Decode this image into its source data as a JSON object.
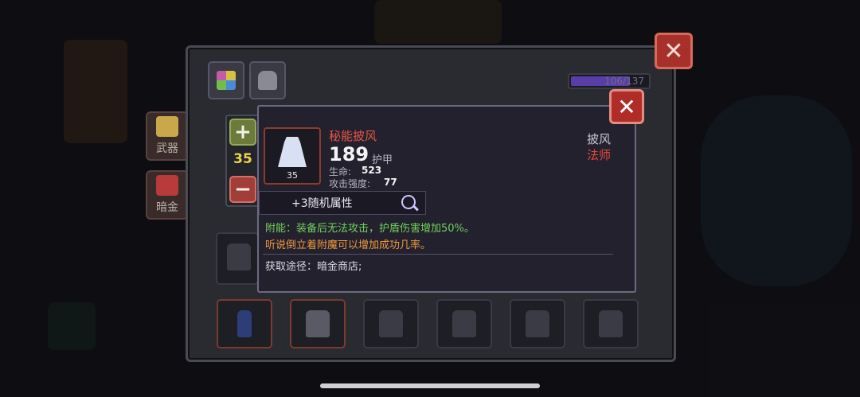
{
  "side_menu": {
    "weapons_label": "武器",
    "dark_gold_label": "暗金"
  },
  "panel": {
    "capacity_text": "106/137",
    "capacity_fraction": 0.77,
    "tabs": [
      {
        "icon": "palette-icon"
      },
      {
        "icon": "skull-helmet-icon"
      }
    ],
    "close_label": "✕"
  },
  "stepper": {
    "plus_label": "+",
    "value": "35",
    "minus_label": "−"
  },
  "item": {
    "name": "秘能披风",
    "level": "35",
    "armor_value": "189",
    "armor_label": "护甲",
    "stats": [
      {
        "label": "生命:",
        "value": "523"
      },
      {
        "label": "攻击强度:",
        "value": "77"
      }
    ],
    "type": "披风",
    "class": "法师",
    "random_attrs_label": "+3随机属性",
    "enchant_text": "附能：装备后无法攻击，护盾伤害增加50%。",
    "hint_text": "听说倒立着附魔可以增加成功几率。",
    "source_text": "获取途径：暗金商店;",
    "close_label": "✕"
  },
  "colors": {
    "rarity_name": "#e8544a",
    "class_color": "#e8473a",
    "enchant_color": "#6fd15a",
    "hint_color": "#ef9a3c",
    "stepper_value": "#f0d34a"
  }
}
